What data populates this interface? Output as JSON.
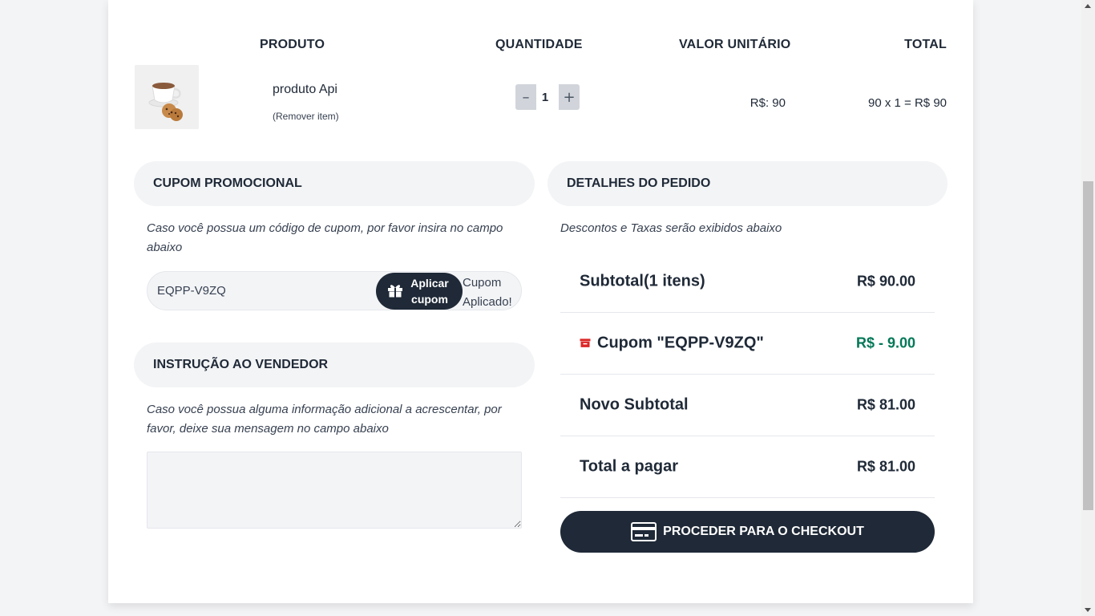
{
  "table": {
    "headers": [
      "PRODUTO",
      "QUANTIDADE",
      "VALOR UNITÁRIO",
      "TOTAL"
    ],
    "item": {
      "name": "produto Api",
      "remove_label": "(Remover item)",
      "quantity": "1",
      "unit_price": "R$: 90",
      "line_total": "90 x 1 = R$ 90",
      "image_icon": "coffee-cookies-photo"
    }
  },
  "coupon_section": {
    "title": "CUPOM PROMOCIONAL",
    "note": "Caso você possua um código de cupom, por favor insira no campo abaixo",
    "input_value": "EQPP-V9ZQ",
    "apply_label_line1": "Aplicar",
    "apply_label_line2": "cupom",
    "status_line1": "Cupom",
    "status_line2": "Aplicado!"
  },
  "seller_section": {
    "title": "INSTRUÇÃO AO VENDEDOR",
    "note": "Caso você possua alguma informação adicional a acrescentar, por favor, deixe sua mensagem no campo abaixo",
    "message_value": ""
  },
  "order_details": {
    "title": "DETALHES DO PEDIDO",
    "note": "Descontos e Taxas serão exibidos abaixo",
    "rows": [
      {
        "label": "Subtotal(1 itens)",
        "value": "R$ 90.00"
      },
      {
        "label": "Cupom \"EQPP-V9ZQ\"",
        "value": "R$ - 9.00"
      },
      {
        "label": "Novo Subtotal",
        "value": "R$ 81.00"
      },
      {
        "label": "Total a pagar",
        "value": "R$ 81.00"
      }
    ],
    "checkout_label": "PROCEDER PARA O CHECKOUT"
  },
  "colors": {
    "primary_dark": "#1f2937",
    "discount_green": "#047857",
    "gift_red": "#dc2626",
    "section_bg": "#f3f4f6"
  }
}
